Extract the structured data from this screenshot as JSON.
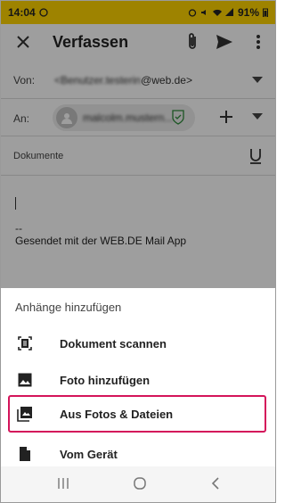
{
  "status_bar": {
    "time": "14:04",
    "battery": "91%",
    "color": "#ffd400"
  },
  "toolbar": {
    "title": "Verfassen",
    "icons": [
      "close-icon",
      "paperclip-icon",
      "send-icon",
      "more-vert-icon"
    ]
  },
  "compose": {
    "from_label": "Von:",
    "from_blurred": "<Benutzer.testerin",
    "from_domain": "@web.de>",
    "to_label": "An:",
    "to_chip_name": "malcolm.mustern...",
    "docs_label": "Dokumente",
    "signature_separator": "--",
    "signature": "Gesendet mit der WEB.DE Mail App"
  },
  "sheet": {
    "title": "Anhänge hinzufügen",
    "items": [
      {
        "label": "Dokument scannen",
        "icon": "scan-document-icon"
      },
      {
        "label": "Foto hinzufügen",
        "icon": "image-icon"
      },
      {
        "label": "Aus Fotos & Dateien",
        "icon": "photo-library-icon"
      },
      {
        "label": "Vom Gerät",
        "icon": "file-icon"
      }
    ],
    "highlight_color": "#d4145a"
  },
  "navbar": {
    "icons": [
      "recent-apps-icon",
      "home-icon",
      "back-icon"
    ]
  }
}
